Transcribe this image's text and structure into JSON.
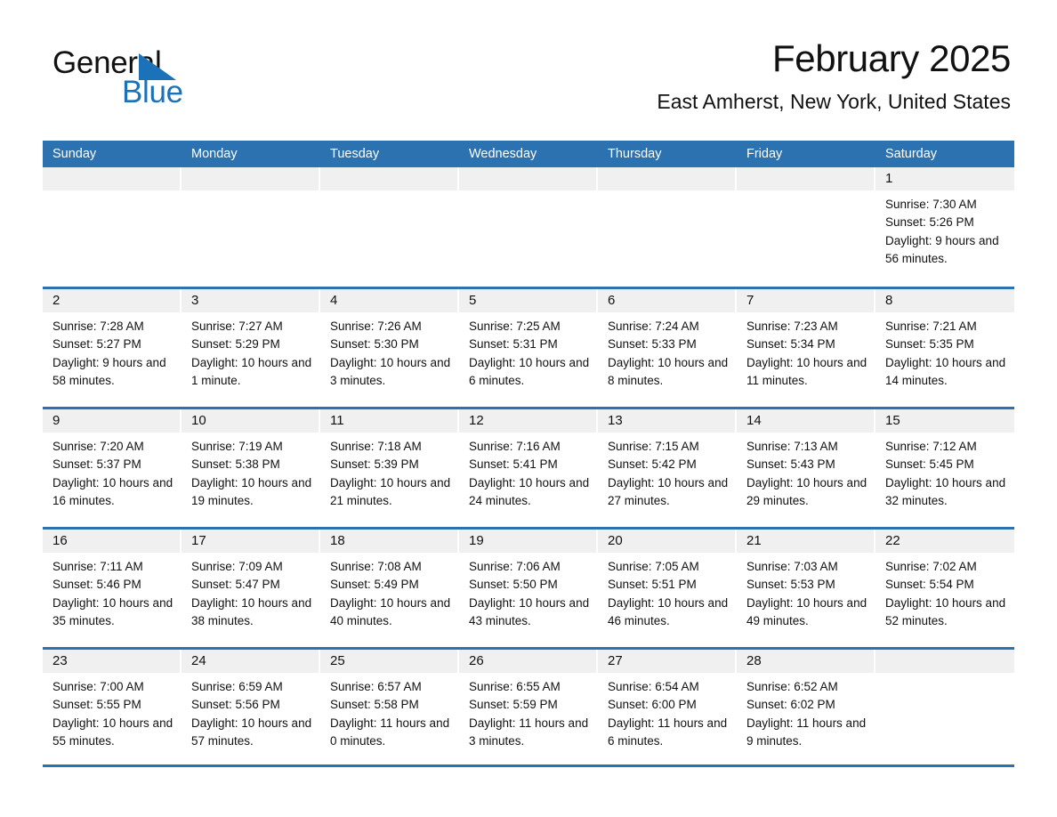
{
  "brand": {
    "name_part1": "General",
    "name_part2": "Blue",
    "logo_icon": "triangle-icon"
  },
  "header": {
    "title": "February 2025",
    "subtitle": "East Amherst, New York, United States"
  },
  "colors": {
    "header_blue": "#2c72b0",
    "brand_blue": "#1b72b8",
    "day_band_gray": "#f0f0f0",
    "text": "#111111"
  },
  "weekdays": [
    "Sunday",
    "Monday",
    "Tuesday",
    "Wednesday",
    "Thursday",
    "Friday",
    "Saturday"
  ],
  "weeks": [
    [
      {
        "day": "",
        "sunrise": "",
        "sunset": "",
        "daylight": ""
      },
      {
        "day": "",
        "sunrise": "",
        "sunset": "",
        "daylight": ""
      },
      {
        "day": "",
        "sunrise": "",
        "sunset": "",
        "daylight": ""
      },
      {
        "day": "",
        "sunrise": "",
        "sunset": "",
        "daylight": ""
      },
      {
        "day": "",
        "sunrise": "",
        "sunset": "",
        "daylight": ""
      },
      {
        "day": "",
        "sunrise": "",
        "sunset": "",
        "daylight": ""
      },
      {
        "day": "1",
        "sunrise": "Sunrise: 7:30 AM",
        "sunset": "Sunset: 5:26 PM",
        "daylight": "Daylight: 9 hours and 56 minutes."
      }
    ],
    [
      {
        "day": "2",
        "sunrise": "Sunrise: 7:28 AM",
        "sunset": "Sunset: 5:27 PM",
        "daylight": "Daylight: 9 hours and 58 minutes."
      },
      {
        "day": "3",
        "sunrise": "Sunrise: 7:27 AM",
        "sunset": "Sunset: 5:29 PM",
        "daylight": "Daylight: 10 hours and 1 minute."
      },
      {
        "day": "4",
        "sunrise": "Sunrise: 7:26 AM",
        "sunset": "Sunset: 5:30 PM",
        "daylight": "Daylight: 10 hours and 3 minutes."
      },
      {
        "day": "5",
        "sunrise": "Sunrise: 7:25 AM",
        "sunset": "Sunset: 5:31 PM",
        "daylight": "Daylight: 10 hours and 6 minutes."
      },
      {
        "day": "6",
        "sunrise": "Sunrise: 7:24 AM",
        "sunset": "Sunset: 5:33 PM",
        "daylight": "Daylight: 10 hours and 8 minutes."
      },
      {
        "day": "7",
        "sunrise": "Sunrise: 7:23 AM",
        "sunset": "Sunset: 5:34 PM",
        "daylight": "Daylight: 10 hours and 11 minutes."
      },
      {
        "day": "8",
        "sunrise": "Sunrise: 7:21 AM",
        "sunset": "Sunset: 5:35 PM",
        "daylight": "Daylight: 10 hours and 14 minutes."
      }
    ],
    [
      {
        "day": "9",
        "sunrise": "Sunrise: 7:20 AM",
        "sunset": "Sunset: 5:37 PM",
        "daylight": "Daylight: 10 hours and 16 minutes."
      },
      {
        "day": "10",
        "sunrise": "Sunrise: 7:19 AM",
        "sunset": "Sunset: 5:38 PM",
        "daylight": "Daylight: 10 hours and 19 minutes."
      },
      {
        "day": "11",
        "sunrise": "Sunrise: 7:18 AM",
        "sunset": "Sunset: 5:39 PM",
        "daylight": "Daylight: 10 hours and 21 minutes."
      },
      {
        "day": "12",
        "sunrise": "Sunrise: 7:16 AM",
        "sunset": "Sunset: 5:41 PM",
        "daylight": "Daylight: 10 hours and 24 minutes."
      },
      {
        "day": "13",
        "sunrise": "Sunrise: 7:15 AM",
        "sunset": "Sunset: 5:42 PM",
        "daylight": "Daylight: 10 hours and 27 minutes."
      },
      {
        "day": "14",
        "sunrise": "Sunrise: 7:13 AM",
        "sunset": "Sunset: 5:43 PM",
        "daylight": "Daylight: 10 hours and 29 minutes."
      },
      {
        "day": "15",
        "sunrise": "Sunrise: 7:12 AM",
        "sunset": "Sunset: 5:45 PM",
        "daylight": "Daylight: 10 hours and 32 minutes."
      }
    ],
    [
      {
        "day": "16",
        "sunrise": "Sunrise: 7:11 AM",
        "sunset": "Sunset: 5:46 PM",
        "daylight": "Daylight: 10 hours and 35 minutes."
      },
      {
        "day": "17",
        "sunrise": "Sunrise: 7:09 AM",
        "sunset": "Sunset: 5:47 PM",
        "daylight": "Daylight: 10 hours and 38 minutes."
      },
      {
        "day": "18",
        "sunrise": "Sunrise: 7:08 AM",
        "sunset": "Sunset: 5:49 PM",
        "daylight": "Daylight: 10 hours and 40 minutes."
      },
      {
        "day": "19",
        "sunrise": "Sunrise: 7:06 AM",
        "sunset": "Sunset: 5:50 PM",
        "daylight": "Daylight: 10 hours and 43 minutes."
      },
      {
        "day": "20",
        "sunrise": "Sunrise: 7:05 AM",
        "sunset": "Sunset: 5:51 PM",
        "daylight": "Daylight: 10 hours and 46 minutes."
      },
      {
        "day": "21",
        "sunrise": "Sunrise: 7:03 AM",
        "sunset": "Sunset: 5:53 PM",
        "daylight": "Daylight: 10 hours and 49 minutes."
      },
      {
        "day": "22",
        "sunrise": "Sunrise: 7:02 AM",
        "sunset": "Sunset: 5:54 PM",
        "daylight": "Daylight: 10 hours and 52 minutes."
      }
    ],
    [
      {
        "day": "23",
        "sunrise": "Sunrise: 7:00 AM",
        "sunset": "Sunset: 5:55 PM",
        "daylight": "Daylight: 10 hours and 55 minutes."
      },
      {
        "day": "24",
        "sunrise": "Sunrise: 6:59 AM",
        "sunset": "Sunset: 5:56 PM",
        "daylight": "Daylight: 10 hours and 57 minutes."
      },
      {
        "day": "25",
        "sunrise": "Sunrise: 6:57 AM",
        "sunset": "Sunset: 5:58 PM",
        "daylight": "Daylight: 11 hours and 0 minutes."
      },
      {
        "day": "26",
        "sunrise": "Sunrise: 6:55 AM",
        "sunset": "Sunset: 5:59 PM",
        "daylight": "Daylight: 11 hours and 3 minutes."
      },
      {
        "day": "27",
        "sunrise": "Sunrise: 6:54 AM",
        "sunset": "Sunset: 6:00 PM",
        "daylight": "Daylight: 11 hours and 6 minutes."
      },
      {
        "day": "28",
        "sunrise": "Sunrise: 6:52 AM",
        "sunset": "Sunset: 6:02 PM",
        "daylight": "Daylight: 11 hours and 9 minutes."
      },
      {
        "day": "",
        "sunrise": "",
        "sunset": "",
        "daylight": ""
      }
    ]
  ]
}
